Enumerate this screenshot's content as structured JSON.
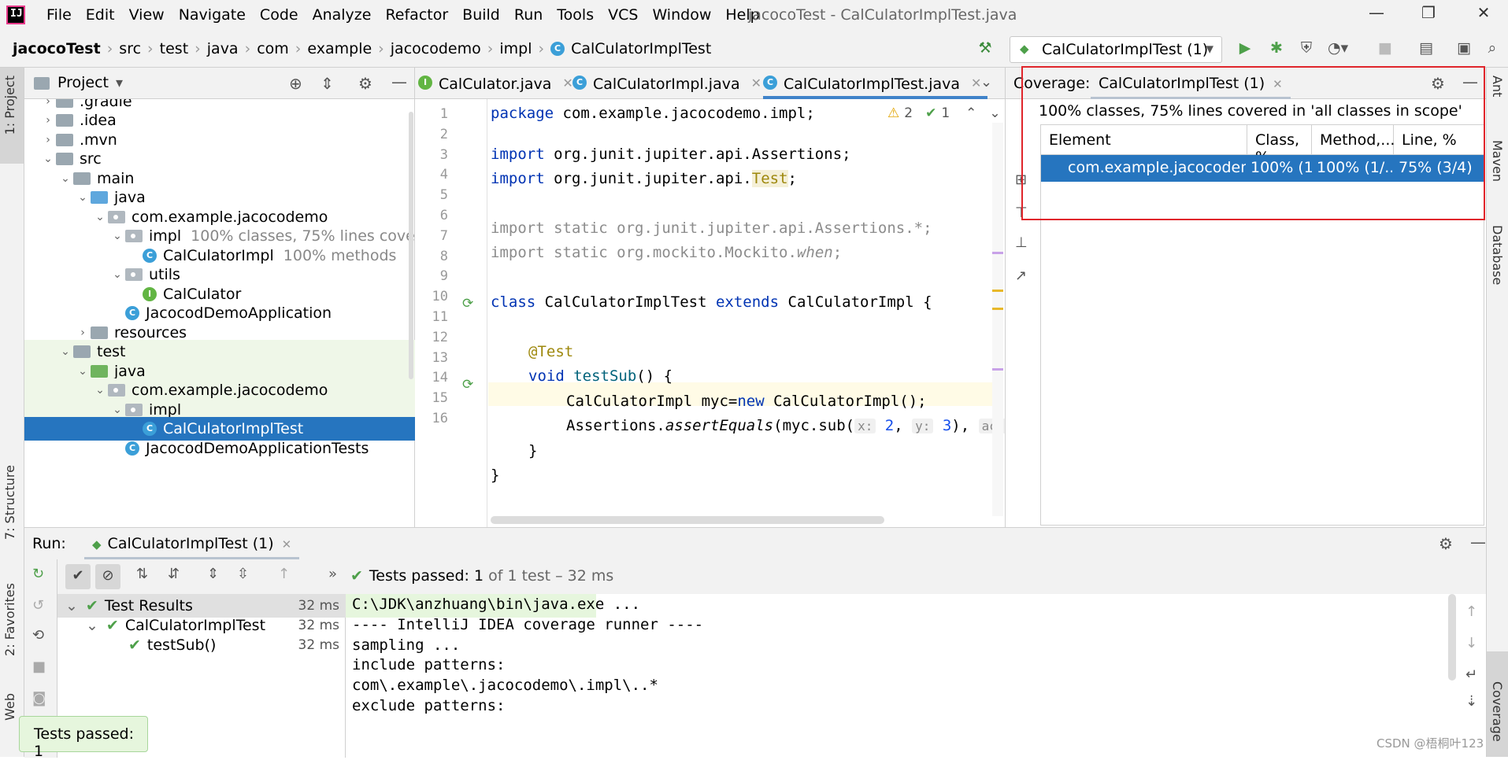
{
  "menubar": {
    "logo": "IJ",
    "menus": [
      "File",
      "Edit",
      "View",
      "Navigate",
      "Code",
      "Analyze",
      "Refactor",
      "Build",
      "Run",
      "Tools",
      "VCS",
      "Window",
      "Help"
    ],
    "window_title": "jacocoTest - CalCulatorImplTest.java",
    "minimize": "—",
    "restore": "❐",
    "close": "✕"
  },
  "navbar": {
    "crumbs": [
      "jacocoTest",
      "src",
      "test",
      "java",
      "com",
      "example",
      "jacocodemo",
      "impl",
      "CalCulatorImplTest"
    ],
    "run_config": "CalCulatorImplTest (1)"
  },
  "side_tabs": {
    "project": "1: Project",
    "structure": "7: Structure",
    "favorites": "2: Favorites",
    "web": "Web",
    "ant": "Ant",
    "maven": "Maven",
    "database": "Database",
    "coverage": "Coverage"
  },
  "project": {
    "title": "Project",
    "tree": [
      {
        "label": ".gradle",
        "muted": "",
        "depth": 1,
        "arrow": "›",
        "icon": "folder"
      },
      {
        "label": ".idea",
        "muted": "",
        "depth": 1,
        "arrow": "›",
        "icon": "folder"
      },
      {
        "label": ".mvn",
        "muted": "",
        "depth": 1,
        "arrow": "›",
        "icon": "folder"
      },
      {
        "label": "src",
        "muted": "",
        "depth": 1,
        "arrow": "⌄",
        "icon": "folder"
      },
      {
        "label": "main",
        "muted": "",
        "depth": 2,
        "arrow": "⌄",
        "icon": "folder"
      },
      {
        "label": "java",
        "muted": "",
        "depth": 3,
        "arrow": "⌄",
        "icon": "folder-blue"
      },
      {
        "label": "com.example.jacocodemo",
        "muted": "",
        "depth": 4,
        "arrow": "⌄",
        "icon": "package"
      },
      {
        "label": "impl",
        "muted": "100% classes, 75% lines cove",
        "depth": 5,
        "arrow": "⌄",
        "icon": "package"
      },
      {
        "label": "CalCulatorImpl",
        "muted": "100% methods",
        "depth": 6,
        "arrow": "",
        "icon": "class"
      },
      {
        "label": "utils",
        "muted": "",
        "depth": 5,
        "arrow": "⌄",
        "icon": "package"
      },
      {
        "label": "CalCulator",
        "muted": "",
        "depth": 6,
        "arrow": "",
        "icon": "interface"
      },
      {
        "label": "JacocodDemoApplication",
        "muted": "",
        "depth": 5,
        "arrow": "",
        "icon": "class"
      },
      {
        "label": "resources",
        "muted": "",
        "depth": 3,
        "arrow": "›",
        "icon": "folder"
      },
      {
        "label": "test",
        "muted": "",
        "depth": 2,
        "arrow": "⌄",
        "icon": "folder"
      },
      {
        "label": "java",
        "muted": "",
        "depth": 3,
        "arrow": "⌄",
        "icon": "folder-green"
      },
      {
        "label": "com.example.jacocodemo",
        "muted": "",
        "depth": 4,
        "arrow": "⌄",
        "icon": "package"
      },
      {
        "label": "impl",
        "muted": "",
        "depth": 5,
        "arrow": "⌄",
        "icon": "package"
      },
      {
        "label": "CalCulatorImplTest",
        "muted": "",
        "depth": 6,
        "arrow": "",
        "icon": "class"
      },
      {
        "label": "JacocodDemoApplicationTests",
        "muted": "",
        "depth": 5,
        "arrow": "",
        "icon": "class"
      }
    ]
  },
  "editor": {
    "tabs": [
      "CalCulator.java",
      "CalCulatorImpl.java",
      "CalCulatorImplTest.java"
    ],
    "active_tab": 2,
    "warnings": "2",
    "checks": "1",
    "line_numbers": [
      "1",
      "2",
      "3",
      "4",
      "5",
      "6",
      "7",
      "8",
      "9",
      "10",
      "11",
      "12",
      "13",
      "14",
      "15",
      "16"
    ]
  },
  "code": {
    "l1_kw": "package",
    "l1_rest": " com.example.jacocodemo.impl;",
    "l3_kw": "import",
    "l3_rest": " org.junit.jupiter.api.Assertions;",
    "l4_kw": "import",
    "l4_rest": " org.junit.jupiter.api.",
    "l4_ann": "Test",
    "l4_end": ";",
    "l6": "import static org.junit.jupiter.api.Assertions.*;",
    "l7_a": "import static org.mockito.Mockito.",
    "l7_b": "when",
    "l7_c": ";",
    "l9_kw1": "class",
    "l9_name": " CalCulatorImplTest ",
    "l9_kw2": "extends",
    "l9_rest": " CalCulatorImpl {",
    "l11": "@Test",
    "l12_kw": "void",
    "l12_fn": " testSub",
    "l12_rest": "() {",
    "l13_a": "CalCulatorImpl myc=",
    "l13_kw": "new",
    "l13_b": " CalCulatorImpl();",
    "l14_a": "Assertions.",
    "l14_fn": "assertEquals",
    "l14_b": "(myc.sub(",
    "l14_h1": "x:",
    "l14_n1": " 2",
    "l14_c": ", ",
    "l14_h2": "y:",
    "l14_n2": " 3",
    "l14_d": "), ",
    "l14_h3": "actu",
    "l15": "}",
    "l16": "}"
  },
  "coverage": {
    "label": "Coverage:",
    "tab": "CalCulatorImplTest (1)",
    "summary": "100% classes, 75% lines covered in 'all classes in scope'",
    "columns": [
      "Element",
      "Class, %",
      "Method,...",
      "Line, %"
    ],
    "row": {
      "element": "com.example.jacocodem...",
      "class": "100% (1/...",
      "method": "100% (1/...",
      "line": "75% (3/4)"
    }
  },
  "run": {
    "label": "Run:",
    "tab": "CalCulatorImplTest (1)",
    "status_prefix": "Tests passed:",
    "status_count": "1",
    "status_suffix": "of 1 test – 32 ms",
    "tests": [
      {
        "name": "Test Results",
        "time": "32 ms",
        "depth": 0
      },
      {
        "name": "CalCulatorImplTest",
        "time": "32 ms",
        "depth": 1
      },
      {
        "name": "testSub()",
        "time": "32 ms",
        "depth": 2
      }
    ],
    "console": [
      "C:\\JDK\\anzhuang\\bin\\java.exe ...",
      "---- IntelliJ IDEA coverage runner ----",
      "sampling ...",
      "include patterns:",
      "com\\.example\\.jacocodemo\\.impl\\..*",
      "exclude patterns:"
    ]
  },
  "toast": "Tests passed: 1",
  "watermark": "CSDN @梧桐叶123",
  "colors": {
    "selection": "#2675bf",
    "highlight_box": "#e0252b",
    "pass": "#4ea04a",
    "keyword": "#0033b3"
  }
}
